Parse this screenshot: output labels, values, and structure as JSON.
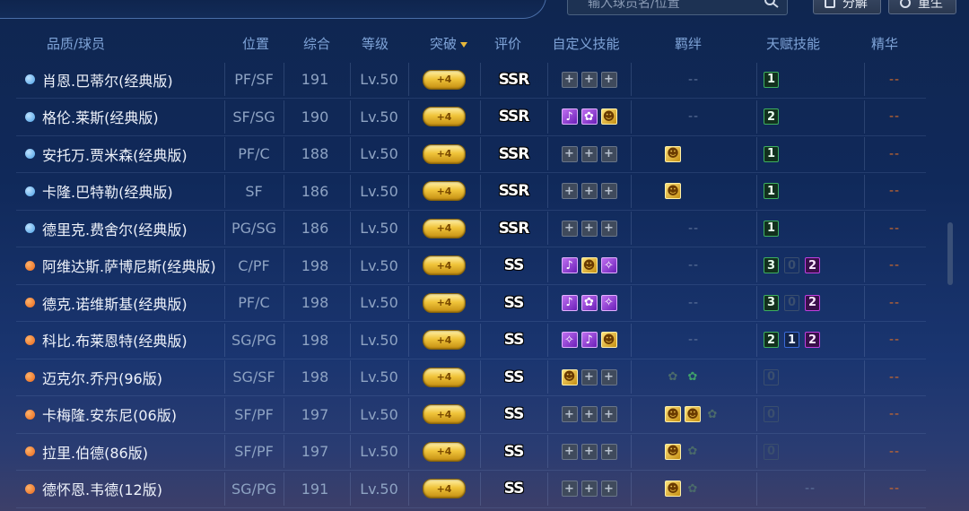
{
  "top": {
    "search_placeholder": "输入球员名/位置",
    "decompose_label": "分解",
    "rebirth_label": "重生"
  },
  "headers": {
    "quality_player": "品质/球员",
    "position": "位置",
    "overall": "综合",
    "level": "等级",
    "breakthrough": "突破",
    "rating": "评价",
    "custom_skills": "自定义技能",
    "bonds": "羁绊",
    "talent_skills": "天赋技能",
    "essence": "精华"
  },
  "colors": {
    "accent_gold": "#f0c43a",
    "header_blue": "#7fa4d8",
    "dash_orange": "#d46b2a"
  },
  "rows": [
    {
      "quality": "blue",
      "name": "肖恩.巴蒂尔(经典版)",
      "pos": "PF/SF",
      "ovr": "191",
      "lv": "Lv.50",
      "brk": "+4",
      "rating": "SSR",
      "skills": [
        "+",
        "+",
        "+"
      ],
      "skill_types": [
        "empty",
        "empty",
        "empty"
      ],
      "bonds": "--",
      "bond_icons": [],
      "talent": [
        "1"
      ],
      "talent_types": [
        "green"
      ],
      "essence": "--"
    },
    {
      "quality": "blue",
      "name": "格伦.莱斯(经典版)",
      "pos": "SF/SG",
      "ovr": "190",
      "lv": "Lv.50",
      "brk": "+4",
      "rating": "SSR",
      "skills": [
        "♪",
        "✿",
        "☻"
      ],
      "skill_types": [
        "purple",
        "purple",
        "gold"
      ],
      "bonds": "--",
      "bond_icons": [],
      "talent": [
        "2"
      ],
      "talent_types": [
        "green"
      ],
      "essence": "--"
    },
    {
      "quality": "blue",
      "name": "安托万.贾米森(经典版)",
      "pos": "PF/C",
      "ovr": "188",
      "lv": "Lv.50",
      "brk": "+4",
      "rating": "SSR",
      "skills": [
        "+",
        "+",
        "+"
      ],
      "skill_types": [
        "empty",
        "empty",
        "empty"
      ],
      "bonds": "",
      "bond_icons": [
        "gold"
      ],
      "talent": [
        "1"
      ],
      "talent_types": [
        "green"
      ],
      "essence": "--"
    },
    {
      "quality": "blue",
      "name": "卡隆.巴特勒(经典版)",
      "pos": "SF",
      "ovr": "186",
      "lv": "Lv.50",
      "brk": "+4",
      "rating": "SSR",
      "skills": [
        "+",
        "+",
        "+"
      ],
      "skill_types": [
        "empty",
        "empty",
        "empty"
      ],
      "bonds": "",
      "bond_icons": [
        "gold"
      ],
      "talent": [
        "1"
      ],
      "talent_types": [
        "green"
      ],
      "essence": "--"
    },
    {
      "quality": "blue",
      "name": "德里克.费舍尔(经典版)",
      "pos": "PG/SG",
      "ovr": "186",
      "lv": "Lv.50",
      "brk": "+4",
      "rating": "SSR",
      "skills": [
        "+",
        "+",
        "+"
      ],
      "skill_types": [
        "empty",
        "empty",
        "empty"
      ],
      "bonds": "--",
      "bond_icons": [],
      "talent": [
        "1"
      ],
      "talent_types": [
        "green"
      ],
      "essence": "--"
    },
    {
      "quality": "orange",
      "name": "阿维达斯.萨博尼斯(经典版)",
      "pos": "C/PF",
      "ovr": "198",
      "lv": "Lv.50",
      "brk": "+4",
      "rating": "SS",
      "skills": [
        "♪",
        "☻",
        "✧"
      ],
      "skill_types": [
        "purple",
        "gold",
        "purple"
      ],
      "bonds": "--",
      "bond_icons": [],
      "talent": [
        "3",
        "0",
        "2"
      ],
      "talent_types": [
        "green",
        "grey",
        "purple"
      ],
      "essence": "--"
    },
    {
      "quality": "orange",
      "name": "德克.诺维斯基(经典版)",
      "pos": "PF/C",
      "ovr": "198",
      "lv": "Lv.50",
      "brk": "+4",
      "rating": "SS",
      "skills": [
        "♪",
        "✿",
        "✧"
      ],
      "skill_types": [
        "purple",
        "purple",
        "purple"
      ],
      "bonds": "--",
      "bond_icons": [],
      "talent": [
        "3",
        "0",
        "2"
      ],
      "talent_types": [
        "green",
        "grey",
        "purple"
      ],
      "essence": "--"
    },
    {
      "quality": "orange",
      "name": "科比.布莱恩特(经典版)",
      "pos": "SG/PG",
      "ovr": "198",
      "lv": "Lv.50",
      "brk": "+4",
      "rating": "SS",
      "skills": [
        "✧",
        "♪",
        "☻"
      ],
      "skill_types": [
        "purple",
        "purple",
        "gold"
      ],
      "bonds": "--",
      "bond_icons": [],
      "talent": [
        "2",
        "1",
        "2"
      ],
      "talent_types": [
        "green",
        "blue",
        "purple"
      ],
      "essence": "--"
    },
    {
      "quality": "orange",
      "name": "迈克尔.乔丹(96版)",
      "pos": "SG/SF",
      "ovr": "198",
      "lv": "Lv.50",
      "brk": "+4",
      "rating": "SS",
      "skills": [
        "☻",
        "+",
        "+"
      ],
      "skill_types": [
        "gold",
        "empty",
        "empty"
      ],
      "bonds": "",
      "bond_icons": [
        "dark",
        "teal"
      ],
      "talent": [
        "0"
      ],
      "talent_types": [
        "grey"
      ],
      "essence": "--"
    },
    {
      "quality": "orange",
      "name": "卡梅隆.安东尼(06版)",
      "pos": "SF/PF",
      "ovr": "197",
      "lv": "Lv.50",
      "brk": "+4",
      "rating": "SS",
      "skills": [
        "+",
        "+",
        "+"
      ],
      "skill_types": [
        "empty",
        "empty",
        "empty"
      ],
      "bonds": "",
      "bond_icons": [
        "gold",
        "gold",
        "dark"
      ],
      "talent": [
        "0"
      ],
      "talent_types": [
        "grey"
      ],
      "essence": "--"
    },
    {
      "quality": "orange",
      "name": "拉里.伯德(86版)",
      "pos": "SF/PF",
      "ovr": "197",
      "lv": "Lv.50",
      "brk": "+4",
      "rating": "SS",
      "skills": [
        "+",
        "+",
        "+"
      ],
      "skill_types": [
        "empty",
        "empty",
        "empty"
      ],
      "bonds": "",
      "bond_icons": [
        "gold",
        "dark"
      ],
      "talent": [
        "0"
      ],
      "talent_types": [
        "grey"
      ],
      "essence": "--"
    },
    {
      "quality": "orange",
      "name": "德怀恩.韦德(12版)",
      "pos": "SG/PG",
      "ovr": "191",
      "lv": "Lv.50",
      "brk": "+4",
      "rating": "SS",
      "skills": [
        "+",
        "+",
        "+"
      ],
      "skill_types": [
        "empty",
        "empty",
        "empty"
      ],
      "bonds": "",
      "bond_icons": [
        "gold",
        "dark"
      ],
      "talent": [
        "--"
      ],
      "talent_types": [
        "dash"
      ],
      "essence": "--"
    }
  ]
}
